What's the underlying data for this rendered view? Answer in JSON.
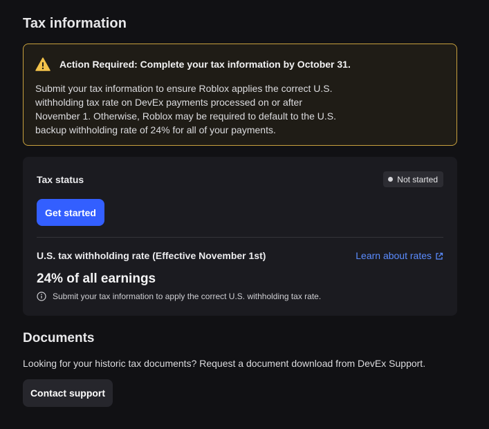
{
  "page": {
    "title": "Tax information"
  },
  "alert": {
    "icon": "warning-triangle-icon",
    "accent": "#f2c24a",
    "title": "Action Required: Complete your tax information by October 31.",
    "body": "Submit your tax information to ensure Roblox applies the correct U.S. withholding tax rate on DevEx payments processed on or after November 1. Otherwise, Roblox may be required to default to the U.S. backup withholding rate of 24% for all of your payments."
  },
  "tax_status": {
    "label": "Tax status",
    "badge": "Not started",
    "get_started_label": "Get started",
    "primary_color": "#335fff"
  },
  "withholding": {
    "label": "U.S. tax withholding rate (Effective November 1st)",
    "learn_link": "Learn about rates",
    "link_icon": "external-link-icon",
    "value": "24% of all earnings",
    "note_icon": "info-icon",
    "note": "Submit your tax information to apply the correct U.S. withholding tax rate."
  },
  "documents": {
    "title": "Documents",
    "description": "Looking for your historic tax documents? Request a document download from DevEx Support.",
    "contact_label": "Contact support"
  }
}
